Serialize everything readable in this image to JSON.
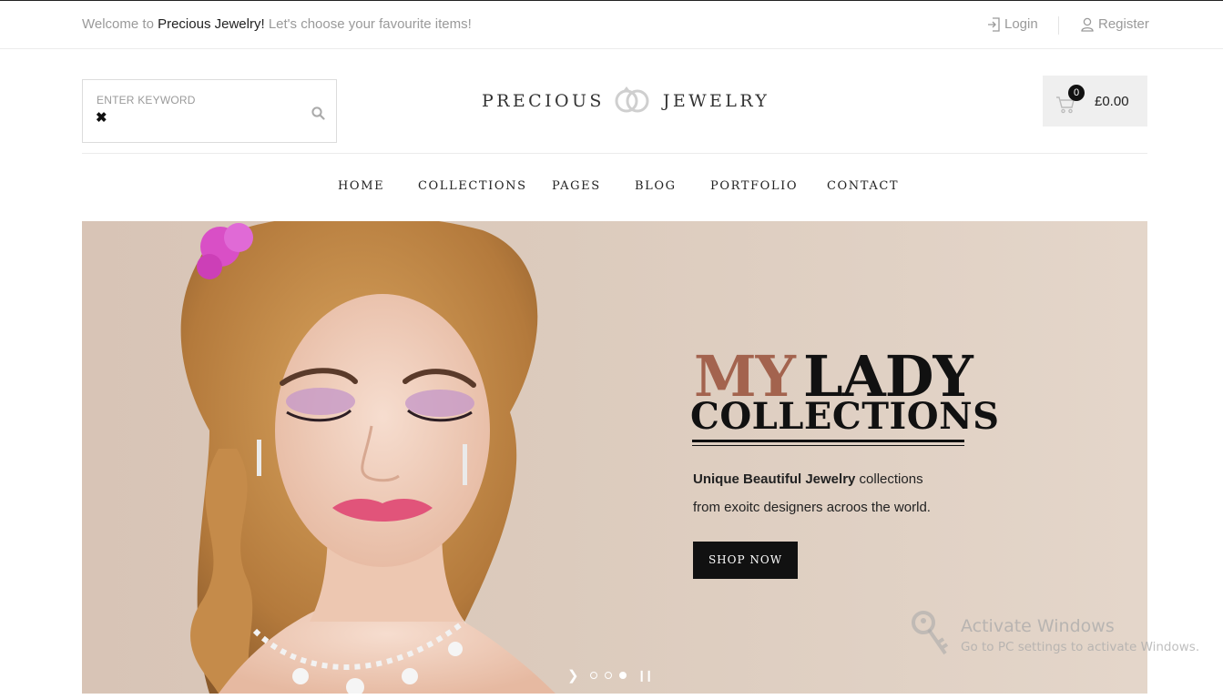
{
  "topbar": {
    "welcome_prefix": "Welcome to",
    "welcome_brand": "Precious Jewelry!",
    "welcome_suffix": "Let's choose your favourite items!",
    "login_label": "Login",
    "register_label": "Register"
  },
  "search": {
    "placeholder": "ENTER KEYWORD",
    "clear_glyph": "✖"
  },
  "logo": {
    "left": "PRECIOUS",
    "right": "JEWELRY"
  },
  "cart": {
    "count": "0",
    "total": "£0.00"
  },
  "nav": {
    "items": [
      "HOME",
      "COLLECTIONS",
      "PAGES",
      "BLOG",
      "PORTFOLIO",
      "CONTACT"
    ]
  },
  "hero": {
    "title_accent": "MY",
    "title_main": "LADY",
    "title_sub": "COLLECTIONS",
    "desc_bold": "Unique Beautiful Jewelry",
    "desc_rest": " collections",
    "desc_line2": "from exoitc designers acroos the world.",
    "button_label": "SHOP NOW",
    "slide_count": 3,
    "active_slide": 3
  },
  "watermark": {
    "title": "Activate Windows",
    "subtitle": "Go to PC settings to activate Windows."
  },
  "colors": {
    "accent": "#a3634e",
    "hero_bg": "#e2d3c6",
    "button_bg": "#111111",
    "cart_bg": "#efefef"
  },
  "icons": [
    "login-icon",
    "user-icon",
    "search-icon",
    "close-icon",
    "rings-icon",
    "cart-icon",
    "chevron-right-icon",
    "pause-icon",
    "key-icon"
  ]
}
